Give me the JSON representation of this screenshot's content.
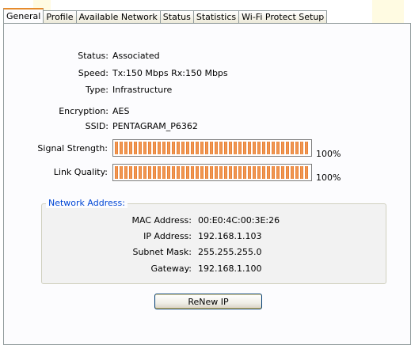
{
  "tabs": [
    {
      "label": "General",
      "active": true
    },
    {
      "label": "Profile",
      "active": false
    },
    {
      "label": "Available Network",
      "active": false
    },
    {
      "label": "Status",
      "active": false
    },
    {
      "label": "Statistics",
      "active": false
    },
    {
      "label": "Wi-Fi Protect Setup",
      "active": false
    }
  ],
  "general": {
    "status_label": "Status:",
    "status_value": "Associated",
    "speed_label": "Speed:",
    "speed_value": "Tx:150 Mbps Rx:150 Mbps",
    "type_label": "Type:",
    "type_value": "Infrastructure",
    "encryption_label": "Encryption:",
    "encryption_value": "AES",
    "ssid_label": "SSID:",
    "ssid_value": "PENTAGRAM_P6362",
    "signal_label": "Signal Strength:",
    "signal_percent": 100,
    "signal_text": "100%",
    "link_label": "Link Quality:",
    "link_percent": 100,
    "link_text": "100%"
  },
  "network_address": {
    "title": "Network Address:",
    "mac_label": "MAC Address:",
    "mac_value": "00:E0:4C:00:3E:26",
    "ip_label": "IP Address:",
    "ip_value": "192.168.1.103",
    "mask_label": "Subnet Mask:",
    "mask_value": "255.255.255.0",
    "gateway_label": "Gateway:",
    "gateway_value": "192.168.1.100"
  },
  "renew_button_label": "ReNew IP",
  "colors": {
    "tab_highlight": "#e68b2c",
    "meter_bar": "#e5782a",
    "group_title": "#0046d5",
    "button_border": "#003c74"
  }
}
